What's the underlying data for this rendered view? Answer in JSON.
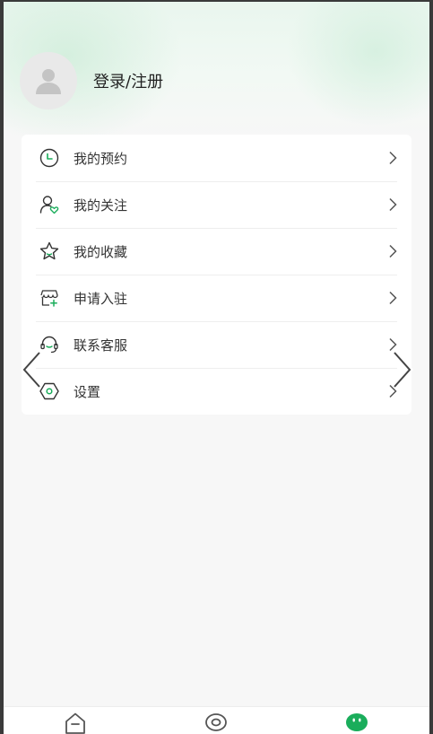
{
  "profile": {
    "avatar_icon": "user-silhouette-icon",
    "login_label": "登录/注册"
  },
  "menu": {
    "items": [
      {
        "label": "我的预约",
        "icon": "clock-icon"
      },
      {
        "label": "我的关注",
        "icon": "user-heart-icon"
      },
      {
        "label": "我的收藏",
        "icon": "star-icon"
      },
      {
        "label": "申请入驻",
        "icon": "store-plus-icon"
      },
      {
        "label": "联系客服",
        "icon": "headset-icon"
      },
      {
        "label": "设置",
        "icon": "hexagon-settings-icon"
      }
    ]
  },
  "tabbar": {
    "tabs": [
      {
        "icon": "home-icon"
      },
      {
        "icon": "eye-icon"
      },
      {
        "icon": "mine-face-icon",
        "active": true
      }
    ]
  },
  "colors": {
    "accent": "#1aad5b",
    "text": "#333333",
    "header_bg": "#e9f6ee",
    "page_bg": "#f7f7f7"
  }
}
